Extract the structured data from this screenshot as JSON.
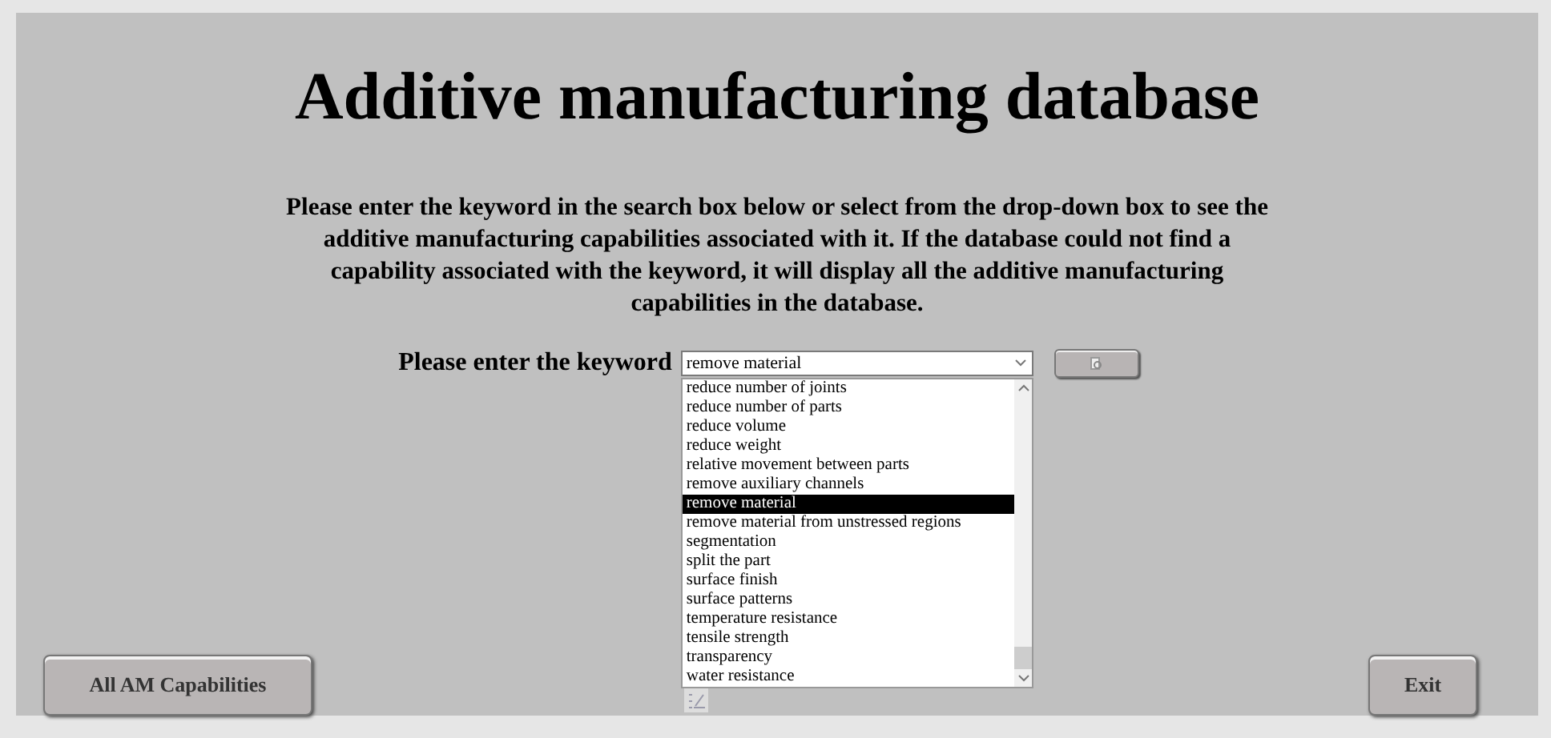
{
  "title": "Additive manufacturing database",
  "instructions": "Please enter the keyword in the search box below or select from the drop-down box to see the additive manufacturing capabilities associated with it. If the database could not find a capability associated with the keyword, it will display all the additive manufacturing capabilities in the database.",
  "keyword": {
    "label": "Please enter the keyword",
    "value": "remove material",
    "expanded": true,
    "options": [
      {
        "label": "reduce number of joints",
        "selected": false
      },
      {
        "label": "reduce number of parts",
        "selected": false
      },
      {
        "label": "reduce volume",
        "selected": false
      },
      {
        "label": "reduce weight",
        "selected": false
      },
      {
        "label": "relative movement between parts",
        "selected": false
      },
      {
        "label": "remove auxiliary channels",
        "selected": false
      },
      {
        "label": "remove material",
        "selected": true
      },
      {
        "label": "remove material from unstressed regions",
        "selected": false
      },
      {
        "label": "segmentation",
        "selected": false
      },
      {
        "label": "split the part",
        "selected": false
      },
      {
        "label": "surface finish",
        "selected": false
      },
      {
        "label": "surface patterns",
        "selected": false
      },
      {
        "label": "temperature resistance",
        "selected": false
      },
      {
        "label": "tensile strength",
        "selected": false
      },
      {
        "label": "transparency",
        "selected": false
      },
      {
        "label": "water resistance",
        "selected": false
      }
    ]
  },
  "buttons": {
    "all": "All AM Capabilities",
    "exit": "Exit"
  }
}
